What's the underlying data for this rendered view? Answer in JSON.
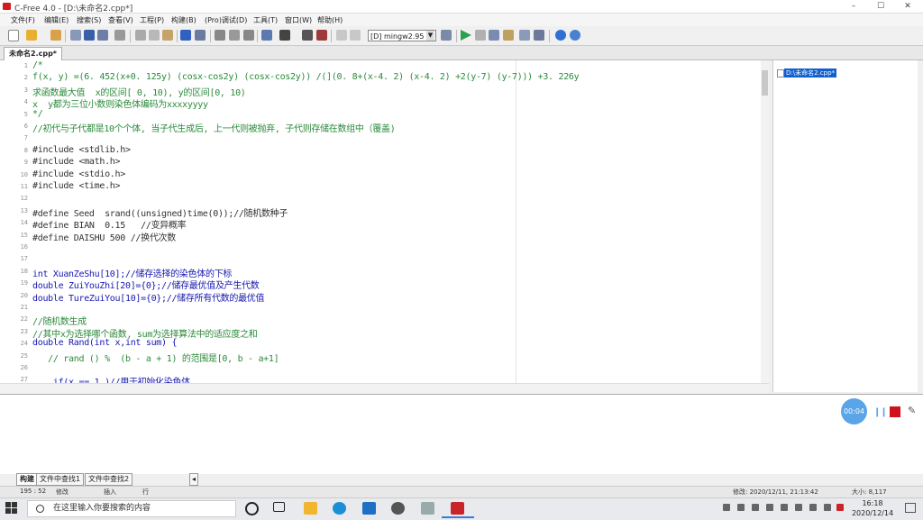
{
  "window": {
    "title": "C-Free 4.0 - [D:\\未命名2.cpp*]",
    "minimize": "–",
    "maximize": "☐",
    "close": "✕"
  },
  "menu": [
    "文件(F)",
    "编辑(E)",
    "搜索(S)",
    "查看(V)",
    "工程(P)",
    "构建(B)",
    "(Pro)调试(D)",
    "工具(T)",
    "窗口(W)",
    "帮助(H)"
  ],
  "toolbar": {
    "compiler": "[D] mingw2.95"
  },
  "tabs": {
    "file_tab": "未命名2.cpp*"
  },
  "editor": {
    "lines": [
      {
        "n": "1",
        "t": "/*"
      },
      {
        "n": "2",
        "t": "f(x, y) =(6. 452(x+0. 125y) (cosx-cos2y) (cosx-cos2y)) /(](0. 8+(x-4. 2) (x-4. 2) +2(y-7) (y-7))) +3. 226y"
      },
      {
        "n": "3",
        "t": "求函数最大值  x的区间[ 0, 10), y的区间[0, 10)"
      },
      {
        "n": "4",
        "t": "x  y都为三位小数则染色体编码为xxxxyyyy"
      },
      {
        "n": "5",
        "t": "*/"
      },
      {
        "n": "6",
        "t": "//初代与子代都是10个个体, 当子代生成后, 上一代则被抛弃, 子代则存储在数组中（覆盖)"
      },
      {
        "n": "7",
        "t": ""
      },
      {
        "n": "8",
        "t": "#include <stdlib.h>"
      },
      {
        "n": "9",
        "t": "#include <math.h>"
      },
      {
        "n": "10",
        "t": "#include <stdio.h>"
      },
      {
        "n": "11",
        "t": "#include <time.h>"
      },
      {
        "n": "12",
        "t": ""
      },
      {
        "n": "13",
        "t": "#define Seed  srand((unsigned)time(0));//随机数种子"
      },
      {
        "n": "14",
        "t": "#define BIAN  0.15   //变异概率"
      },
      {
        "n": "15",
        "t": "#define DAISHU 500 //换代次数"
      },
      {
        "n": "16",
        "t": ""
      },
      {
        "n": "17",
        "t": ""
      },
      {
        "n": "18",
        "t": "int XuanZeShu[10];//储存选择的染色体的下标"
      },
      {
        "n": "19",
        "t": "double ZuiYouZhi[20]={0};//储存最优值及产生代数"
      },
      {
        "n": "20",
        "t": "double TureZuiYou[10]={0};//储存所有代数的最优值"
      },
      {
        "n": "21",
        "t": ""
      },
      {
        "n": "22",
        "t": "//随机数生成"
      },
      {
        "n": "23",
        "t": "//其中x为选择哪个函数, sum为选择算法中的适应度之和"
      },
      {
        "n": "24",
        "t": "double Rand(int x,int sum) {"
      },
      {
        "n": "25",
        "t": "   // rand () %  (b - a + 1) 的范围是[0, b - a+1]"
      },
      {
        "n": "26",
        "t": ""
      },
      {
        "n": "27",
        "t": "    if(x == 1 )//用于初始化染色体"
      }
    ]
  },
  "file_tree": {
    "item": "D:\\未命名2.cpp*"
  },
  "recorder": {
    "timer": "00:04",
    "pause": "❙❙",
    "pen": "✎"
  },
  "bottom_tabs": [
    "构建",
    "文件中查找1",
    "文件中查找2"
  ],
  "status": {
    "position": "195 : 52",
    "modified": "修改",
    "insert": "插入",
    "row": "行",
    "mod_time": "修改: 2020/12/11, 21:13:42",
    "size": "大小: 8,117"
  },
  "taskbar": {
    "search_placeholder": "在这里输入你要搜索的内容",
    "time": "16:18",
    "date": "2020/12/14"
  }
}
